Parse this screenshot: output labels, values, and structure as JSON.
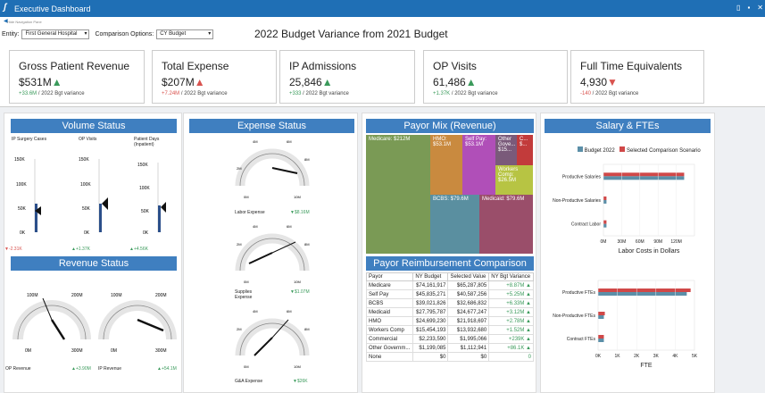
{
  "app": {
    "title": "Executive Dashboard",
    "nav_hide": "Hide Navigation Pane"
  },
  "filters": {
    "entity_label": "Entity:",
    "entity_value": "First General Hospital",
    "comparison_label": "Comparison Options:",
    "comparison_value": "CY Budget"
  },
  "page_title": "2022 Budget Variance from 2021 Budget",
  "kpis": [
    {
      "title": "Gross Patient Revenue",
      "value": "$531M",
      "dir": "up",
      "variance": "+33.6M",
      "suffix": " / 2022 Bgt variance"
    },
    {
      "title": "Total Expense",
      "value": "$207M",
      "dir": "up",
      "variance": "+7.24M",
      "suffix": " / 2022 Bgt variance"
    },
    {
      "title": "IP Admissions",
      "value": "25,846",
      "dir": "up",
      "variance": "+333",
      "suffix": " / 2022 Bgt variance"
    },
    {
      "title": "OP Visits",
      "value": "61,486",
      "dir": "up",
      "variance": "+1.37K",
      "suffix": " / 2022 Bgt variance"
    },
    {
      "title": "Full Time Equivalents",
      "value": "4,930",
      "dir": "down",
      "variance": "-140",
      "suffix": " / 2022 Bgt variance"
    }
  ],
  "volume": {
    "title": "Volume Status",
    "cols": [
      {
        "label": "IP Surgery Cases",
        "ticks": [
          "150K",
          "100K",
          "50K",
          "0K"
        ],
        "variance": "-2.31K",
        "dir": "down",
        "fill": 0.05
      },
      {
        "label": "OP Visits",
        "ticks": [
          "150K",
          "100K",
          "50K",
          "0K"
        ],
        "variance": "+1.37K",
        "dir": "up",
        "fill": 0.4
      },
      {
        "label": "Patient Days (Inpatient)",
        "ticks": [
          "150K",
          "100K",
          "50K",
          "0K"
        ],
        "variance": "+4.56K",
        "dir": "up",
        "fill": 0.35
      }
    ]
  },
  "revenue": {
    "title": "Revenue Status",
    "gauges": [
      {
        "label": "OP Revenue",
        "variance": "+3.90M",
        "dir": "up",
        "ticks": [
          "100M",
          "200M",
          "0M",
          "300M"
        ]
      },
      {
        "label": "IP Revenue",
        "variance": "+54.1M",
        "dir": "up",
        "ticks": [
          "100M",
          "200M",
          "0M",
          "300M"
        ]
      }
    ]
  },
  "expense": {
    "title": "Expense Status",
    "gauges": [
      {
        "label": "Labor Expense",
        "variance": "$8.16M",
        "dir": "down",
        "ticks": [
          "4M",
          "6M",
          "2M",
          "8M",
          "0M",
          "10M"
        ]
      },
      {
        "label": "Supplies Expense",
        "variance": "$1.07M",
        "dir": "down",
        "ticks": [
          "4M",
          "6M",
          "2M",
          "8M",
          "0M",
          "10M"
        ]
      },
      {
        "label": "G&A Expense",
        "variance": "$26K",
        "dir": "down",
        "ticks": [
          "4M",
          "6M",
          "2M",
          "8M",
          "0M",
          "10M"
        ]
      }
    ]
  },
  "payor_mix": {
    "title": "Payor Mix (Revenue)",
    "tiles": [
      {
        "label": "Medicare: $212M",
        "color": "#7a9a55"
      },
      {
        "label": "HMO: $53.1M",
        "color": "#c98a3f"
      },
      {
        "label": "Self Pay: $53.1M",
        "color": "#b04fb8"
      },
      {
        "label": "Other Gove... $15...",
        "color": "#7a5a7a"
      },
      {
        "label": "C... $...",
        "color": "#c23b3b"
      },
      {
        "label": "Workers Comp: $26.5M",
        "color": "#b7c443"
      },
      {
        "label": "BCBS: $79.6M",
        "color": "#5a8fa0"
      },
      {
        "label": "Medicaid: $79.6M",
        "color": "#9a4e6a"
      }
    ]
  },
  "reimb": {
    "title": "Payor Reimbursement Comparison",
    "headers": [
      "Payor",
      "NY Budget",
      "Selected Value",
      "NY Bgt Variance"
    ],
    "rows": [
      [
        "Medicare",
        "$74,161,917",
        "$65,287,805",
        "+8.87M"
      ],
      [
        "Self Pay",
        "$45,835,271",
        "$40,587,256",
        "+5.25M"
      ],
      [
        "BCBS",
        "$39,021,826",
        "$32,686,832",
        "+6.33M"
      ],
      [
        "Medicaid",
        "$27,795,787",
        "$24,677,247",
        "+3.12M"
      ],
      [
        "HMO",
        "$24,699,230",
        "$21,918,697",
        "+2.78M"
      ],
      [
        "Workers Comp",
        "$15,454,193",
        "$13,932,680",
        "+1.52M"
      ],
      [
        "Commercial",
        "$2,233,590",
        "$1,995,066",
        "+239K"
      ],
      [
        "Other Governm...",
        "$1,199,085",
        "$1,112,941",
        "+86.1K"
      ],
      [
        "None",
        "$0",
        "$0",
        "0"
      ]
    ]
  },
  "salary": {
    "title": "Salary & FTEs",
    "legend": [
      "Budget 2022",
      "Selected Comparison Scenario"
    ],
    "colors": {
      "budget": "#5b8fa8",
      "selected": "#d04848"
    }
  },
  "chart_data": [
    {
      "type": "bar",
      "orientation": "horizontal",
      "categories": [
        "Productive Salaries",
        "Non-Productive Salaries",
        "Contract Labor"
      ],
      "series": [
        {
          "name": "Budget 2022",
          "values": [
            133,
            5,
            5
          ]
        },
        {
          "name": "Selected Comparison Scenario",
          "values": [
            133,
            5,
            5
          ]
        }
      ],
      "xlabel": "Labor Costs in Dollars",
      "xticks": [
        "0M",
        "30M",
        "60M",
        "90M",
        "120M"
      ],
      "xlim": [
        0,
        150
      ]
    },
    {
      "type": "bar",
      "orientation": "horizontal",
      "categories": [
        "Productive FTEs",
        "Non-Productive FTEs",
        "Contract FTEs"
      ],
      "series": [
        {
          "name": "Budget 2022",
          "values": [
            4600,
            300,
            300
          ]
        },
        {
          "name": "Selected Comparison Scenario",
          "values": [
            4800,
            350,
            300
          ]
        }
      ],
      "xlabel": "FTE",
      "xticks": [
        "0K",
        "1K",
        "2K",
        "3K",
        "4K",
        "5K"
      ],
      "xlim": [
        0,
        5000
      ]
    }
  ]
}
